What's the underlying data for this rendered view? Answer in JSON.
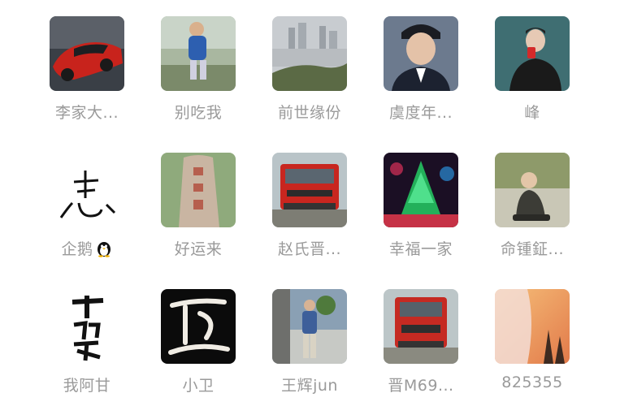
{
  "contacts": [
    {
      "name": "李家大...",
      "icon": "red-sports-car-photo"
    },
    {
      "name": "别吃我",
      "icon": "child-outdoor-photo"
    },
    {
      "name": "前世缘份",
      "icon": "city-river-photo"
    },
    {
      "name": "虞度年...",
      "icon": "man-in-suit-photo"
    },
    {
      "name": "峰",
      "icon": "man-with-phone-photo"
    },
    {
      "name": "企鹅",
      "icon": "calligraphy-sketch",
      "badge": "penguin-icon"
    },
    {
      "name": "好运来",
      "icon": "stone-tablet-photo"
    },
    {
      "name": "赵氏晋...",
      "icon": "red-truck-photo"
    },
    {
      "name": "幸福一家",
      "icon": "green-light-tower-photo"
    },
    {
      "name": "命锺鉦...",
      "icon": "child-sitting-photo"
    },
    {
      "name": "我阿甘",
      "icon": "black-calligraphy"
    },
    {
      "name": "小卫",
      "icon": "white-calligraphy-on-black"
    },
    {
      "name": "王辉jun",
      "icon": "man-standing-photo"
    },
    {
      "name": "晋M69...",
      "icon": "red-truck-front-photo"
    },
    {
      "name": "825355",
      "icon": "sunset-person-photo"
    }
  ]
}
